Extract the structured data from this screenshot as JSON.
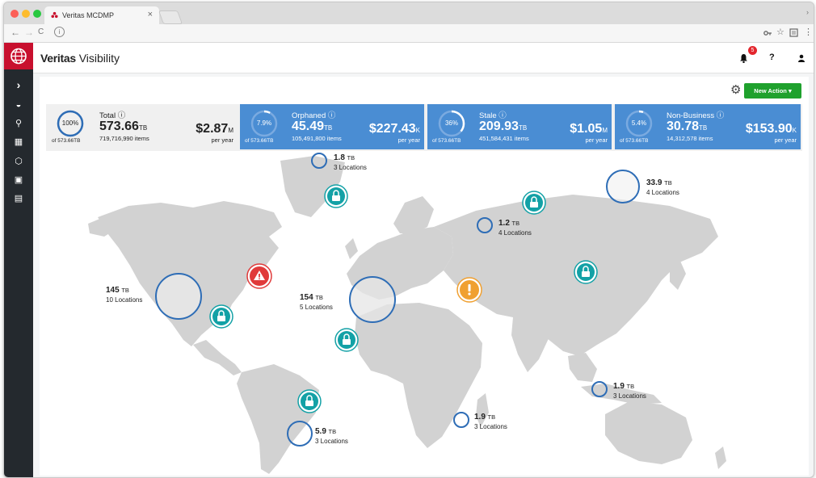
{
  "browser": {
    "tab_title": "Veritas MCDMP",
    "tab_close": "×",
    "tab_menu_chevron": "›",
    "nav": {
      "back": "←",
      "forward": "→",
      "reload": "C",
      "info": "i"
    },
    "toolbar_icons": [
      "key-icon",
      "star-icon",
      "cast-icon",
      "menu-icon"
    ]
  },
  "colors": {
    "accent_blue": "#4a8dd3",
    "brand_red": "#c8102e",
    "action_green": "#1fa12d",
    "alert_red": "#e03a3a",
    "alert_orange": "#f0a030",
    "lock_teal": "#13a1a6",
    "ring_blue": "#2e6db6"
  },
  "app": {
    "brand_bold": "Veritas",
    "brand_light": " Visibility",
    "notifications_count": "5",
    "help": "?",
    "new_action": "New Action ▾"
  },
  "sidebar": {
    "items": [
      {
        "name": "expand-icon",
        "glyph": "›"
      },
      {
        "name": "dashboard-icon",
        "glyph": "◒"
      },
      {
        "name": "pin-icon",
        "glyph": "⚲"
      },
      {
        "name": "grid-icon",
        "glyph": "▦"
      },
      {
        "name": "cube-icon",
        "glyph": "⬡"
      },
      {
        "name": "report-icon",
        "glyph": "▣"
      },
      {
        "name": "list-icon",
        "glyph": "▤"
      }
    ]
  },
  "stats": {
    "total": {
      "title": "Total ⓘ",
      "pct": "100%",
      "of": "of 573.66TB",
      "value": "573.66",
      "unit": "TB",
      "items": "719,716,990 items",
      "money": "$2.87",
      "money_unit": "M",
      "per_year": "per year",
      "fraction": 1.0
    },
    "orphaned": {
      "title": "Orphaned ⓘ",
      "pct": "7.9%",
      "of": "of 573.66TB",
      "value": "45.49",
      "unit": "TB",
      "items": "105,491,800 items",
      "money": "$227.43",
      "money_unit": "K",
      "per_year": "per year",
      "fraction": 0.079
    },
    "stale": {
      "title": "Stale ⓘ",
      "pct": "36%",
      "of": "of 573.66TB",
      "value": "209.93",
      "unit": "TB",
      "items": "451,584,431 items",
      "money": "$1.05",
      "money_unit": "M",
      "per_year": "per year",
      "fraction": 0.36
    },
    "nonbusiness": {
      "title": "Non-Business ⓘ",
      "pct": "5.4%",
      "of": "of 573.66TB",
      "value": "30.78",
      "unit": "TB",
      "items": "14,312,578 items",
      "money": "$153.90",
      "money_unit": "K",
      "per_year": "per year",
      "fraction": 0.054
    }
  },
  "map": {
    "locations": [
      {
        "name": "north-america",
        "value": "145",
        "unit": "TB",
        "locations": "10 Locations"
      },
      {
        "name": "europe",
        "value": "154",
        "unit": "TB",
        "locations": "5 Locations"
      },
      {
        "name": "greenland",
        "value": "1.8",
        "unit": "TB",
        "locations": "3 Locations"
      },
      {
        "name": "russia-north",
        "value": "1.2",
        "unit": "TB",
        "locations": "4 Locations"
      },
      {
        "name": "russia-east",
        "value": "33.9",
        "unit": "TB",
        "locations": "4 Locations"
      },
      {
        "name": "south-america",
        "value": "5.9",
        "unit": "TB",
        "locations": "3 Locations"
      },
      {
        "name": "madagascar",
        "value": "1.9",
        "unit": "TB",
        "locations": "3 Locations"
      },
      {
        "name": "indonesia",
        "value": "1.9",
        "unit": "TB",
        "locations": "3 Locations"
      }
    ],
    "alerts": [
      "Critical alert",
      "Warning alert"
    ]
  }
}
